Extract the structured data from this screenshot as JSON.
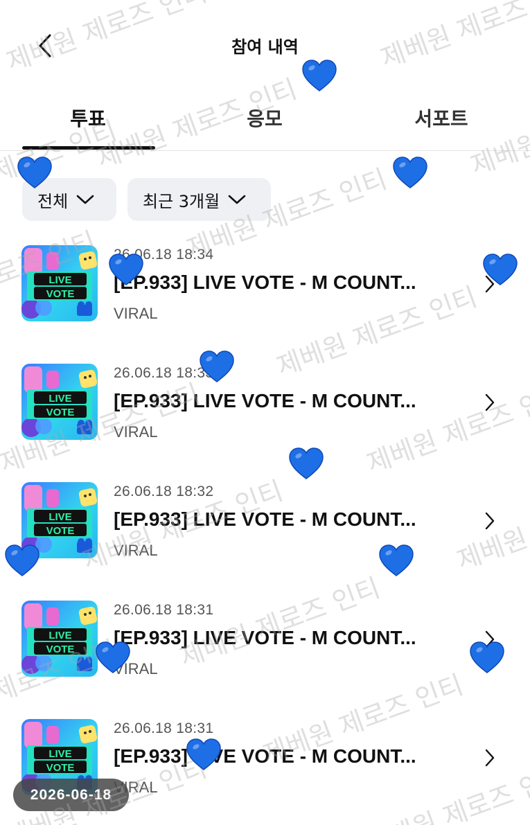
{
  "header": {
    "title": "참여 내역",
    "back_icon": "chevron-left-icon"
  },
  "tabs": [
    {
      "label": "투표",
      "active": true
    },
    {
      "label": "응모",
      "active": false
    },
    {
      "label": "서포트",
      "active": false
    }
  ],
  "filters": [
    {
      "label": "전체",
      "icon": "chevron-down-icon"
    },
    {
      "label": "최근 3개월",
      "icon": "chevron-down-icon"
    }
  ],
  "entries": [
    {
      "date": "26.06.18 18:34",
      "title": "[EP.933] LIVE VOTE - M COUNT...",
      "category": "VIRAL",
      "thumb_text": [
        "LIVE",
        "VOTE"
      ]
    },
    {
      "date": "26.06.18 18:33",
      "title": "[EP.933] LIVE VOTE - M COUNT...",
      "category": "VIRAL",
      "thumb_text": [
        "LIVE",
        "VOTE"
      ]
    },
    {
      "date": "26.06.18 18:32",
      "title": "[EP.933] LIVE VOTE - M COUNT...",
      "category": "VIRAL",
      "thumb_text": [
        "LIVE",
        "VOTE"
      ]
    },
    {
      "date": "26.06.18 18:31",
      "title": "[EP.933] LIVE VOTE - M COUNT...",
      "category": "VIRAL",
      "thumb_text": [
        "LIVE",
        "VOTE"
      ]
    },
    {
      "date": "26.06.18 18:31",
      "title": "[EP.933] LIVE VOTE - M COUNT...",
      "category": "VIRAL",
      "thumb_text": [
        "LIVE",
        "VOTE"
      ]
    }
  ],
  "date_overlay": "2026-06-18",
  "watermark": "제베원 제로즈 인티",
  "colors": {
    "heart": "#1e6fe6",
    "tab_active": "#111111",
    "chip_bg": "#eef0f3"
  }
}
